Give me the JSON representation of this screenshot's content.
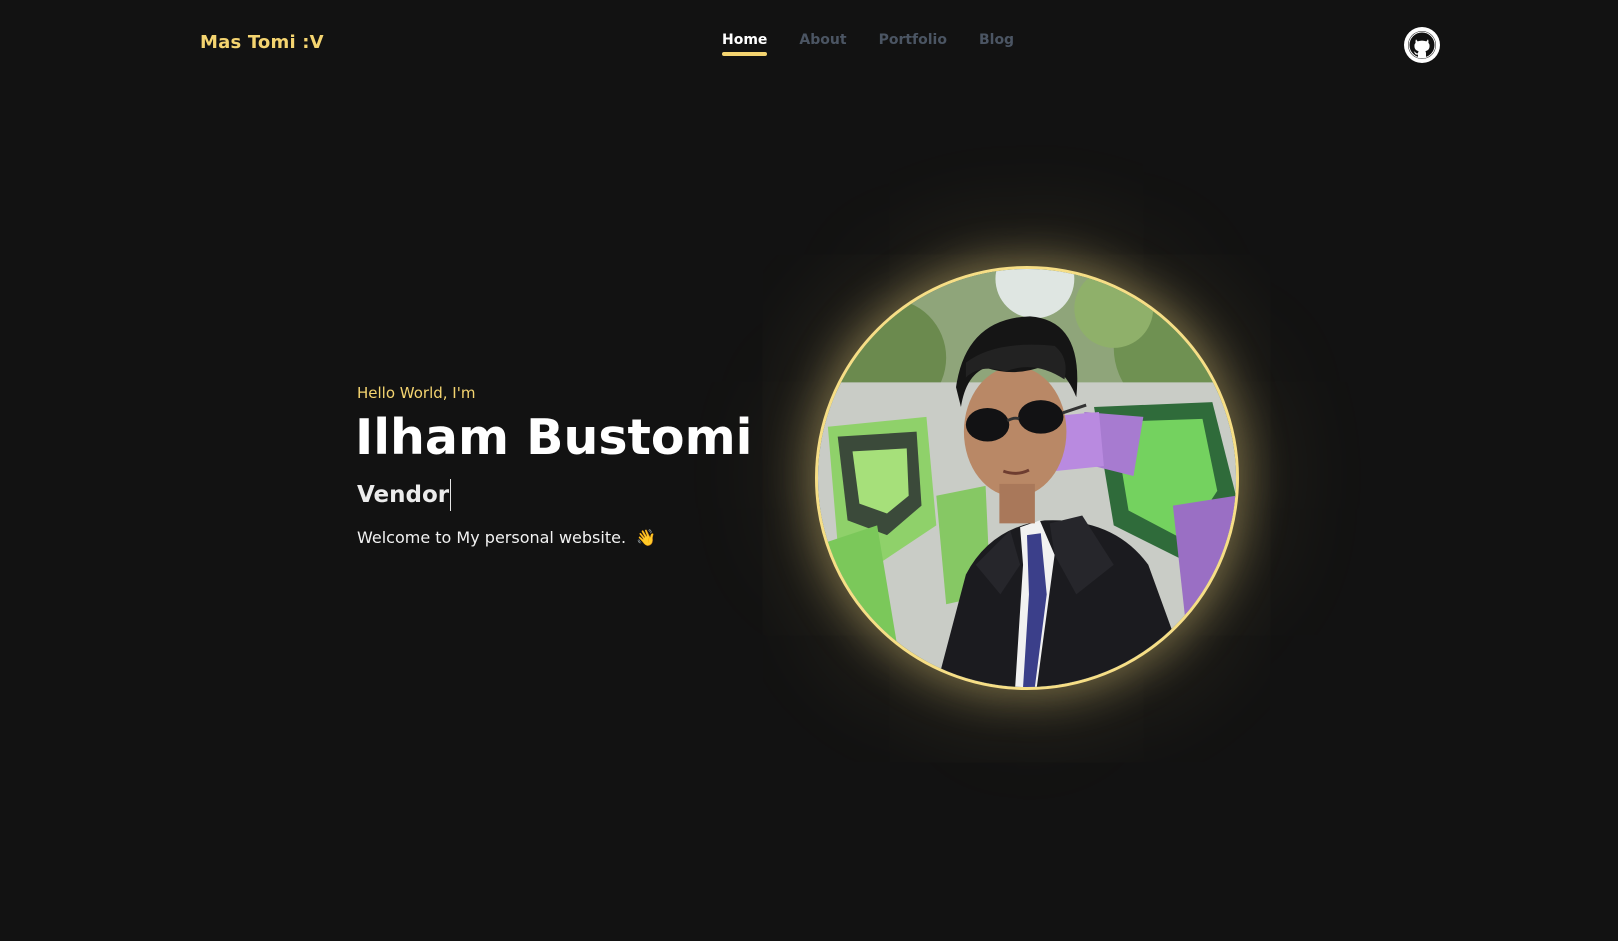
{
  "header": {
    "brand": "Mas Tomi :V",
    "nav": [
      {
        "label": "Home",
        "active": true
      },
      {
        "label": "About",
        "active": false
      },
      {
        "label": "Portfolio",
        "active": false
      },
      {
        "label": "Blog",
        "active": false
      }
    ],
    "github_icon": "github-icon"
  },
  "hero": {
    "greeting": "Hello World, I'm",
    "name": "Ilham Bustomi",
    "role": "Vendor",
    "welcome": "Welcome to My personal website.",
    "wave_emoji": "👋"
  },
  "portrait": {
    "icon": "profile-photo"
  },
  "colors": {
    "background": "#121212",
    "accent": "#f4d470",
    "nav_inactive": "#4b5563",
    "text": "#ffffff"
  }
}
